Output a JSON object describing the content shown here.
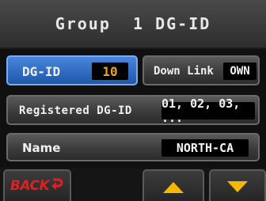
{
  "title": {
    "group_label": "Group",
    "group_number": "1",
    "suffix": "DG-ID"
  },
  "rows": {
    "dgid": {
      "label": "DG-ID",
      "value": "10"
    },
    "downlink": {
      "label": "Down Link",
      "value": "OWN"
    },
    "registered": {
      "label": "Registered DG-ID",
      "value": "01, 02, 03, ..."
    },
    "name": {
      "label": "Name",
      "value": "NORTH-CA"
    }
  },
  "softkeys": {
    "back_label": "BACK"
  },
  "icons": {
    "back": "return-arrow-icon",
    "up": "triangle-up-icon",
    "down": "triangle-down-icon"
  },
  "colors": {
    "selected": "#2f6cc2",
    "amber": "#f0a020",
    "back_red": "#e02020",
    "arrow_yellow": "#f5b800"
  }
}
